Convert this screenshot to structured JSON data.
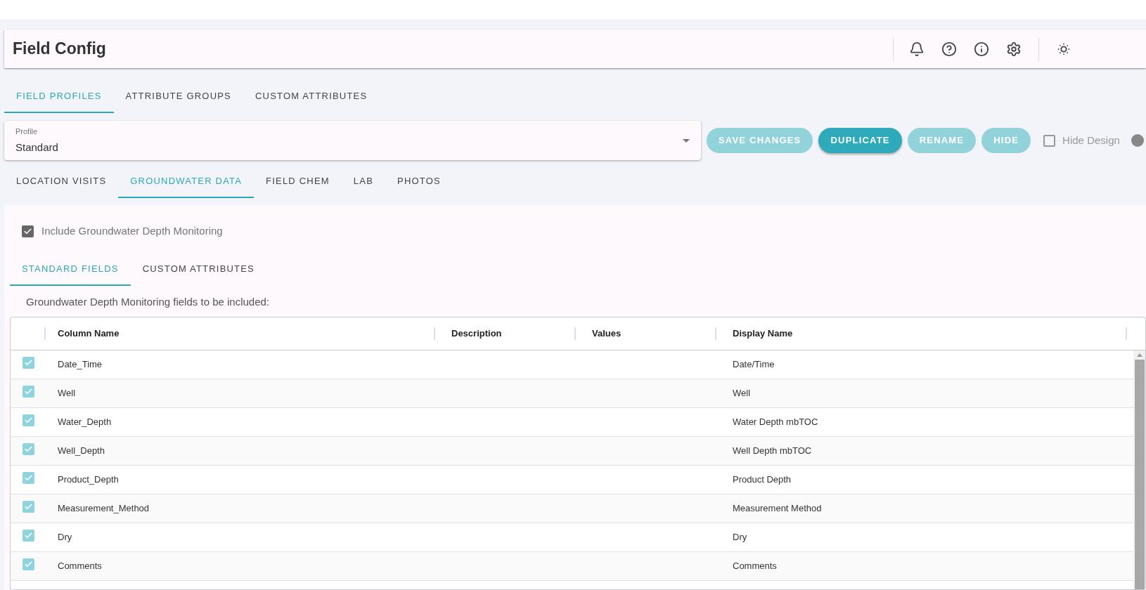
{
  "header": {
    "title": "Field Config"
  },
  "main_tabs": [
    {
      "label": "FIELD PROFILES",
      "selected": true
    },
    {
      "label": "ATTRIBUTE GROUPS",
      "selected": false
    },
    {
      "label": "CUSTOM ATTRIBUTES",
      "selected": false
    }
  ],
  "profile": {
    "label": "Profile",
    "value": "Standard"
  },
  "actions": [
    {
      "label": "SAVE CHANGES",
      "disabled": true
    },
    {
      "label": "DUPLICATE",
      "disabled": false
    },
    {
      "label": "RENAME",
      "disabled": true
    },
    {
      "label": "HIDE",
      "disabled": true
    }
  ],
  "hide_design": {
    "label": "Hide Design",
    "checked": false
  },
  "data_tabs": [
    {
      "label": "LOCATION VISITS",
      "selected": false
    },
    {
      "label": "GROUNDWATER DATA",
      "selected": true
    },
    {
      "label": "FIELD CHEM",
      "selected": false
    },
    {
      "label": "LAB",
      "selected": false
    },
    {
      "label": "PHOTOS",
      "selected": false
    }
  ],
  "include_monitoring": {
    "label": "Include Groundwater Depth Monitoring",
    "checked": true
  },
  "field_tabs": [
    {
      "label": "STANDARD FIELDS",
      "selected": true
    },
    {
      "label": "CUSTOM ATTRIBUTES",
      "selected": false
    }
  ],
  "intro": "Groundwater Depth Monitoring fields to be included:",
  "table": {
    "columns": [
      "Column Name",
      "Description",
      "Values",
      "Display Name"
    ],
    "rows": [
      {
        "checked": true,
        "column_name": "Date_Time",
        "display_name": "Date/Time"
      },
      {
        "checked": true,
        "column_name": "Well",
        "display_name": "Well"
      },
      {
        "checked": true,
        "column_name": "Water_Depth",
        "display_name": "Water Depth mbTOC"
      },
      {
        "checked": true,
        "column_name": "Well_Depth",
        "display_name": "Well Depth mbTOC"
      },
      {
        "checked": true,
        "column_name": "Product_Depth",
        "display_name": "Product Depth"
      },
      {
        "checked": true,
        "column_name": "Measurement_Method",
        "display_name": "Measurement Method"
      },
      {
        "checked": true,
        "column_name": "Dry",
        "display_name": "Dry"
      },
      {
        "checked": true,
        "column_name": "Comments",
        "display_name": "Comments"
      }
    ]
  }
}
